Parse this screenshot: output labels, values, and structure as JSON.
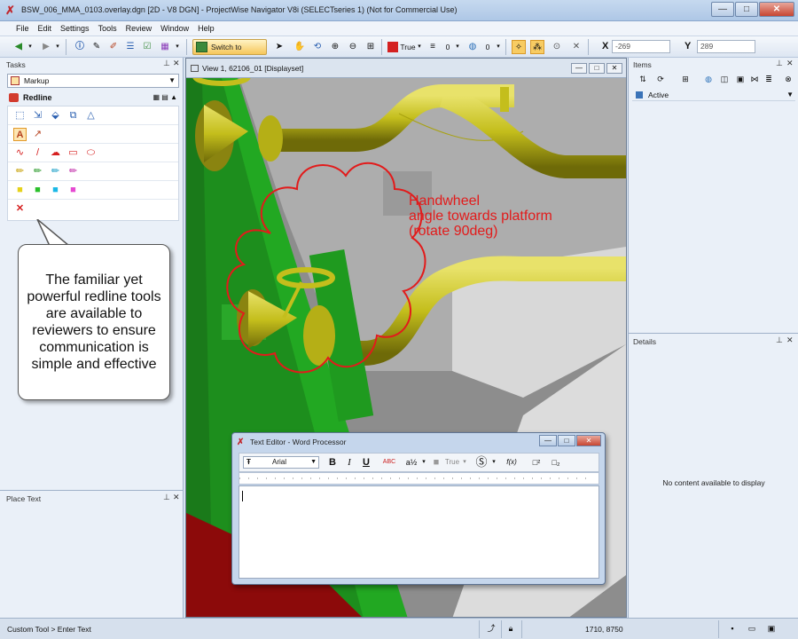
{
  "window": {
    "title": "BSW_006_MMA_0103.overlay.dgn [2D - V8 DGN] - ProjectWise Navigator V8i (SELECTseries 1) (Not for Commercial Use)",
    "minimize": "—",
    "maximize": "□",
    "close": "✕"
  },
  "menu": [
    "File",
    "Edit",
    "Settings",
    "Tools",
    "Review",
    "Window",
    "Help"
  ],
  "toolbar": {
    "switch_to_review": "Switch to Review",
    "true_label": "True",
    "weight_value": "0",
    "style_value": "0",
    "x_label": "X",
    "x_value": "-269",
    "y_label": "Y",
    "y_value": "289"
  },
  "tasks": {
    "header": "Tasks",
    "dropdown_value": "Markup",
    "section_title": "Redline"
  },
  "callout": {
    "text": "The familiar yet powerful redline tools are available to reviewers to ensure communication is simple and effective"
  },
  "place_text": {
    "header": "Place Text"
  },
  "view": {
    "title": "View 1, 62106_01 [Displayset]",
    "annotation_line1": "Handwheel",
    "annotation_line2": "angle towards platform",
    "annotation_line3": "(rotate 90deg)"
  },
  "text_editor": {
    "title": "Text Editor - Word Processor",
    "font": "Arial",
    "bold": "B",
    "italic": "I",
    "underline": "U",
    "spell": "ABC",
    "true_label": "True",
    "fx": "f(x)"
  },
  "items": {
    "header": "Items",
    "active": "Active"
  },
  "details": {
    "header": "Details",
    "empty": "No content available to display"
  },
  "status": {
    "prompt": "Custom Tool > Enter Text",
    "coordinates": "1710, 8750"
  },
  "colors": {
    "redline": "#e21b1b",
    "pipe": "#c8c21a",
    "structure_green": "#22a822",
    "floor_red": "#8c0a0a"
  }
}
